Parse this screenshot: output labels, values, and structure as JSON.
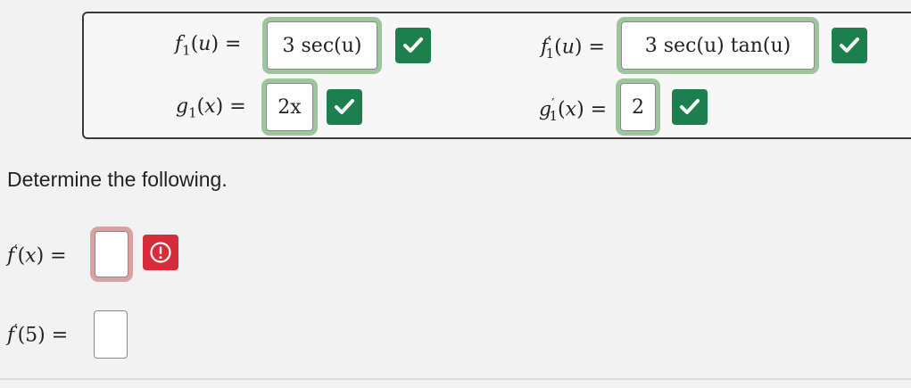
{
  "given": {
    "f1": {
      "lhs_name": "f",
      "lhs_sub": "1",
      "lhs_var": "u",
      "answer": "3 sec(u)",
      "status": "correct"
    },
    "g1": {
      "lhs_name": "g",
      "lhs_sub": "1",
      "lhs_var": "x",
      "answer": "2x",
      "status": "correct"
    },
    "f1_prime": {
      "lhs_name": "f",
      "lhs_prime": "′",
      "lhs_sub": "1",
      "lhs_var": "u",
      "answer": "3 sec(u) tan(u)",
      "status": "correct"
    },
    "g1_prime": {
      "lhs_name": "g",
      "lhs_prime": "′",
      "lhs_sub": "1",
      "lhs_var": "x",
      "answer": "2",
      "status": "correct"
    }
  },
  "instruction": "Determine the following.",
  "questions": {
    "f_prime_x": {
      "lhs_name": "f",
      "lhs_prime": "′",
      "lhs_var": "x",
      "value": "",
      "status": "incorrect"
    },
    "f_prime_5": {
      "lhs_name": "f",
      "lhs_prime": "′",
      "lhs_var": "5",
      "value": ""
    }
  },
  "equals": "=",
  "icons": {
    "correct": "check-icon",
    "incorrect": "exclamation-circle-icon"
  },
  "colors": {
    "correct_badge": "#1d7f4d",
    "correct_ring": "#9dc69c",
    "incorrect_badge": "#d92c3a",
    "incorrect_ring": "#d9a2a2"
  }
}
